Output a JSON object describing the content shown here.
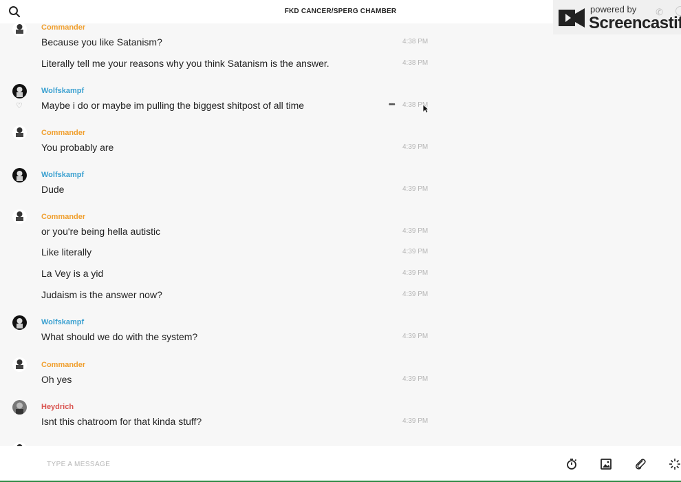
{
  "header": {
    "title": "FKD CANCER/SPERG CHAMBER"
  },
  "screencastify": {
    "powered_by": "powered by",
    "brand": "Screencastify"
  },
  "colors": {
    "commander": "#f0a030",
    "wolfskampf": "#3aa0d0",
    "heydrich": "#d9534f"
  },
  "messages": [
    {
      "author": "Commander",
      "text": "Because you like Satanism?",
      "time": "4:38 PM"
    },
    {
      "author": "",
      "text": "Literally tell me your reasons why you think Satanism is the answer.",
      "time": "4:38 PM"
    },
    {
      "author": "Wolfskampf",
      "text": "Maybe i do or maybe im pulling the biggest shitpost of all time",
      "time": "4:38 PM"
    },
    {
      "author": "Commander",
      "text": "You probably are",
      "time": "4:39 PM"
    },
    {
      "author": "Wolfskampf",
      "text": "Dude",
      "time": "4:39 PM"
    },
    {
      "author": "Commander",
      "text": "or you're being hella autistic",
      "time": "4:39 PM"
    },
    {
      "author": "",
      "text": "Like literally",
      "time": "4:39 PM"
    },
    {
      "author": "",
      "text": "La Vey is a yid",
      "time": "4:39 PM"
    },
    {
      "author": "",
      "text": "Judaism is the answer now?",
      "time": "4:39 PM"
    },
    {
      "author": "Wolfskampf",
      "text": "What should we do with the system?",
      "time": "4:39 PM"
    },
    {
      "author": "Commander",
      "text": "Oh yes",
      "time": "4:39 PM"
    },
    {
      "author": "Heydrich",
      "text": "Isnt this chatroom for that kinda stuff?",
      "time": "4:39 PM"
    }
  ],
  "composer": {
    "placeholder": "TYPE A MESSAGE"
  }
}
